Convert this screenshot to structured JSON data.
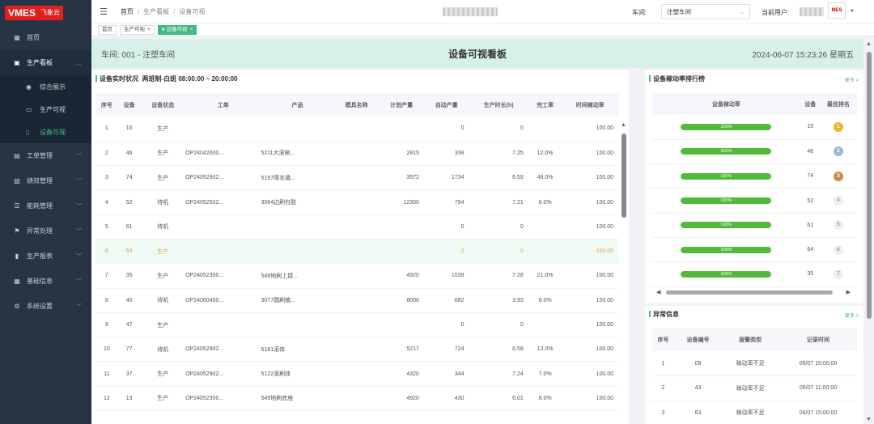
{
  "logo": {
    "brand": "VMES",
    "sub": "飞象云"
  },
  "sidebar": {
    "items": [
      {
        "label": "首页",
        "icon": "dashboard-icon",
        "glyph": "▦"
      },
      {
        "label": "生产看板",
        "icon": "board-icon",
        "glyph": "▣",
        "open": true
      },
      {
        "label": "工单管理",
        "icon": "order-icon",
        "glyph": "▤"
      },
      {
        "label": "绩效管理",
        "icon": "performance-icon",
        "glyph": "▧"
      },
      {
        "label": "能耗管理",
        "icon": "energy-icon",
        "glyph": "☰"
      },
      {
        "label": "异常处理",
        "icon": "exception-icon",
        "glyph": "⚑"
      },
      {
        "label": "生产报表",
        "icon": "report-icon",
        "glyph": "▮"
      },
      {
        "label": "基础信息",
        "icon": "info-icon",
        "glyph": "▦"
      },
      {
        "label": "系统设置",
        "icon": "settings-icon",
        "glyph": "⚙"
      }
    ],
    "submenu": [
      {
        "label": "综合展示",
        "glyph": "◉"
      },
      {
        "label": "生产可视",
        "glyph": "▭"
      },
      {
        "label": "设备可视",
        "glyph": "▯",
        "active": true
      }
    ]
  },
  "header": {
    "breadcrumb": [
      "首页",
      "生产看板",
      "设备可视"
    ],
    "workshop_label": "车间:",
    "workshop_value": "注塑车间",
    "user_label": "当前用户:"
  },
  "tabs": [
    {
      "label": "首页"
    },
    {
      "label": "生产可视",
      "close": "×"
    },
    {
      "label": "设备可视",
      "close": "×",
      "active": true,
      "dot": "●"
    }
  ],
  "board": {
    "workshop": "车间: 001 - 注塑车间",
    "title": "设备可视看板",
    "datetime": "2024-06-07 15:23:26 星期五"
  },
  "status_panel": {
    "title": "设备实时状况",
    "shift": "两班制-白班 08:00:00 ~ 20:00:00",
    "columns": [
      "序号",
      "设备",
      "设备状态",
      "工单",
      "产品",
      "模具名称",
      "计划产量",
      "自动产量",
      "生产时长(h)",
      "完工率",
      "时间稼动率"
    ],
    "rows": [
      [
        "1",
        "15",
        "生产",
        "",
        "",
        "",
        "",
        "0",
        "0",
        "",
        "100.00"
      ],
      [
        "2",
        "46",
        "生产",
        "OP24042000...",
        "5211大滚刷...",
        "",
        "2815",
        "338",
        "7.25",
        "12.0%",
        "100.00"
      ],
      [
        "3",
        "74",
        "生产",
        "OP24052902...",
        "5197障本撬...",
        "",
        "3572",
        "1734",
        "6.59",
        "48.0%",
        "100.00"
      ],
      [
        "4",
        "52",
        "待机",
        "OP24052502...",
        "3064边刷包胶",
        "",
        "12300",
        "794",
        "7.21",
        "6.0%",
        "100.00"
      ],
      [
        "5",
        "61",
        "待机",
        "",
        "",
        "",
        "",
        "0",
        "0",
        "",
        "100.00"
      ],
      [
        "6",
        "64",
        "生产",
        "",
        "",
        "",
        "",
        "0",
        "0",
        "",
        "100.00"
      ],
      [
        "7",
        "35",
        "生产",
        "OP24052300...",
        "549地刷上接...",
        "",
        "4920",
        "1038",
        "7.28",
        "21.0%",
        "100.00"
      ],
      [
        "8",
        "40",
        "待机",
        "OP24060400...",
        "3077圆刷植...",
        "",
        "8000",
        "682",
        "3.93",
        "8.0%",
        "100.00"
      ],
      [
        "9",
        "47",
        "生产",
        "",
        "",
        "",
        "",
        "0",
        "0",
        "",
        "100.00"
      ],
      [
        "10",
        "77",
        "待机",
        "OP24052902...",
        "5181滚体",
        "",
        "5217",
        "724",
        "6.58",
        "13.0%",
        "100.00"
      ],
      [
        "11",
        "37",
        "生产",
        "OP24052902...",
        "5122滚刷体",
        "",
        "4320",
        "344",
        "7.24",
        "7.0%",
        "100.00"
      ],
      [
        "12",
        "13",
        "生产",
        "OP24052300...",
        "549地刷底座",
        "",
        "4920",
        "430",
        "6.01",
        "8.0%",
        "100.00"
      ]
    ]
  },
  "ranking_panel": {
    "title": "设备稼动率排行榜",
    "more": "更多 >",
    "columns": [
      "设备稼动率",
      "设备",
      "最佳排名"
    ],
    "rows": [
      {
        "rate": "100%",
        "fill": 1.0,
        "device": "15",
        "rank": "1"
      },
      {
        "rate": "100%",
        "fill": 1.0,
        "device": "46",
        "rank": "2"
      },
      {
        "rate": "100%",
        "fill": 1.0,
        "device": "74",
        "rank": "3"
      },
      {
        "rate": "100%",
        "fill": 1.0,
        "device": "52",
        "rank": "4"
      },
      {
        "rate": "100%",
        "fill": 1.0,
        "device": "61",
        "rank": "5"
      },
      {
        "rate": "100%",
        "fill": 1.0,
        "device": "64",
        "rank": "6"
      },
      {
        "rate": "100%",
        "fill": 1.0,
        "device": "35",
        "rank": "7"
      }
    ]
  },
  "exception_panel": {
    "title": "异常信息",
    "more": "更多 >",
    "columns": [
      "序号",
      "设备编号",
      "报警类型",
      "记录时间"
    ],
    "rows": [
      [
        "1",
        "09",
        "稼动率不足",
        "06/07 15:00:00"
      ],
      [
        "2",
        "43",
        "稼动率不足",
        "06/07 11:00:00"
      ],
      [
        "3",
        "63",
        "稼动率不足",
        "06/07 15:00:00"
      ]
    ]
  },
  "colors": {
    "accent": "#42b983",
    "run": "#67c23a",
    "wait": "#e6a23c",
    "sidebar": "#263445"
  }
}
